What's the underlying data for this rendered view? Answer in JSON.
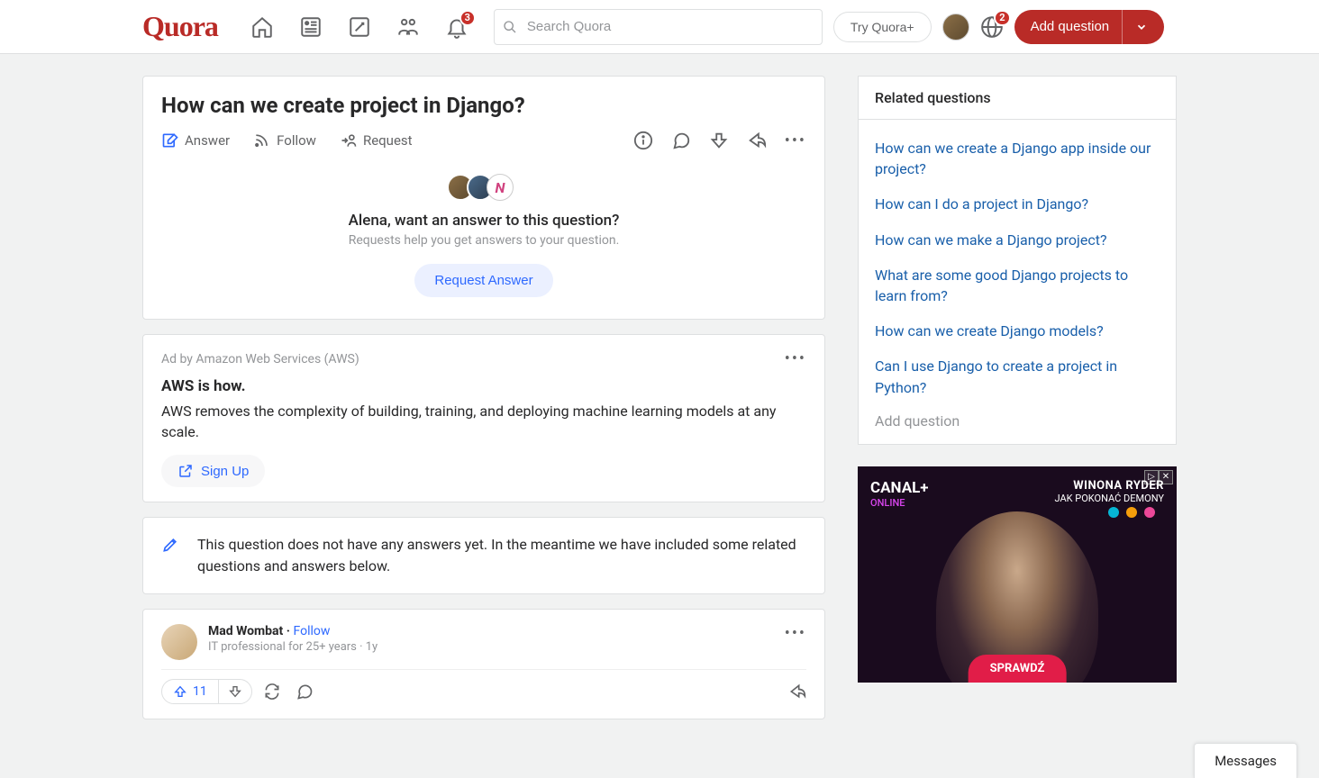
{
  "header": {
    "logo": "Quora",
    "search_placeholder": "Search Quora",
    "try_plus": "Try Quora+",
    "add_question": "Add question",
    "notif_badge": "3",
    "globe_badge": "2"
  },
  "question": {
    "title": "How can we create project in Django?",
    "answer": "Answer",
    "follow": "Follow",
    "request": "Request",
    "req_title": "Alena, want an answer to this question?",
    "req_sub": "Requests help you get answers to your question.",
    "req_btn": "Request Answer"
  },
  "ad": {
    "by": "Ad by Amazon Web Services (AWS)",
    "title": "AWS is how.",
    "text": "AWS removes the complexity of building, training, and deploying machine learning models at any scale.",
    "cta": "Sign Up"
  },
  "note": {
    "text": "This question does not have any answers yet. In the meantime we have included some related questions and answers below."
  },
  "answer": {
    "name": "Mad Wombat",
    "follow": "Follow",
    "meta": "IT professional for 25+ years · 1y",
    "upvotes": "11"
  },
  "related": {
    "heading": "Related questions",
    "items": [
      "How can we create a Django app inside our project?",
      "How can I do a project in Django?",
      "How can we make a Django project?",
      "What are some good Django projects to learn from?",
      "How can we create Django models?",
      "Can I use Django to create a project in Python?"
    ],
    "add": "Add question"
  },
  "side_ad": {
    "brand": "CANAL+",
    "brand_sub": "ONLINE",
    "movie": "WINONA RYDER",
    "movie_sub": "JAK POKONAĆ DEMONY",
    "cta": "SPRAWDŹ"
  },
  "messages": "Messages",
  "avatar_n": "N"
}
